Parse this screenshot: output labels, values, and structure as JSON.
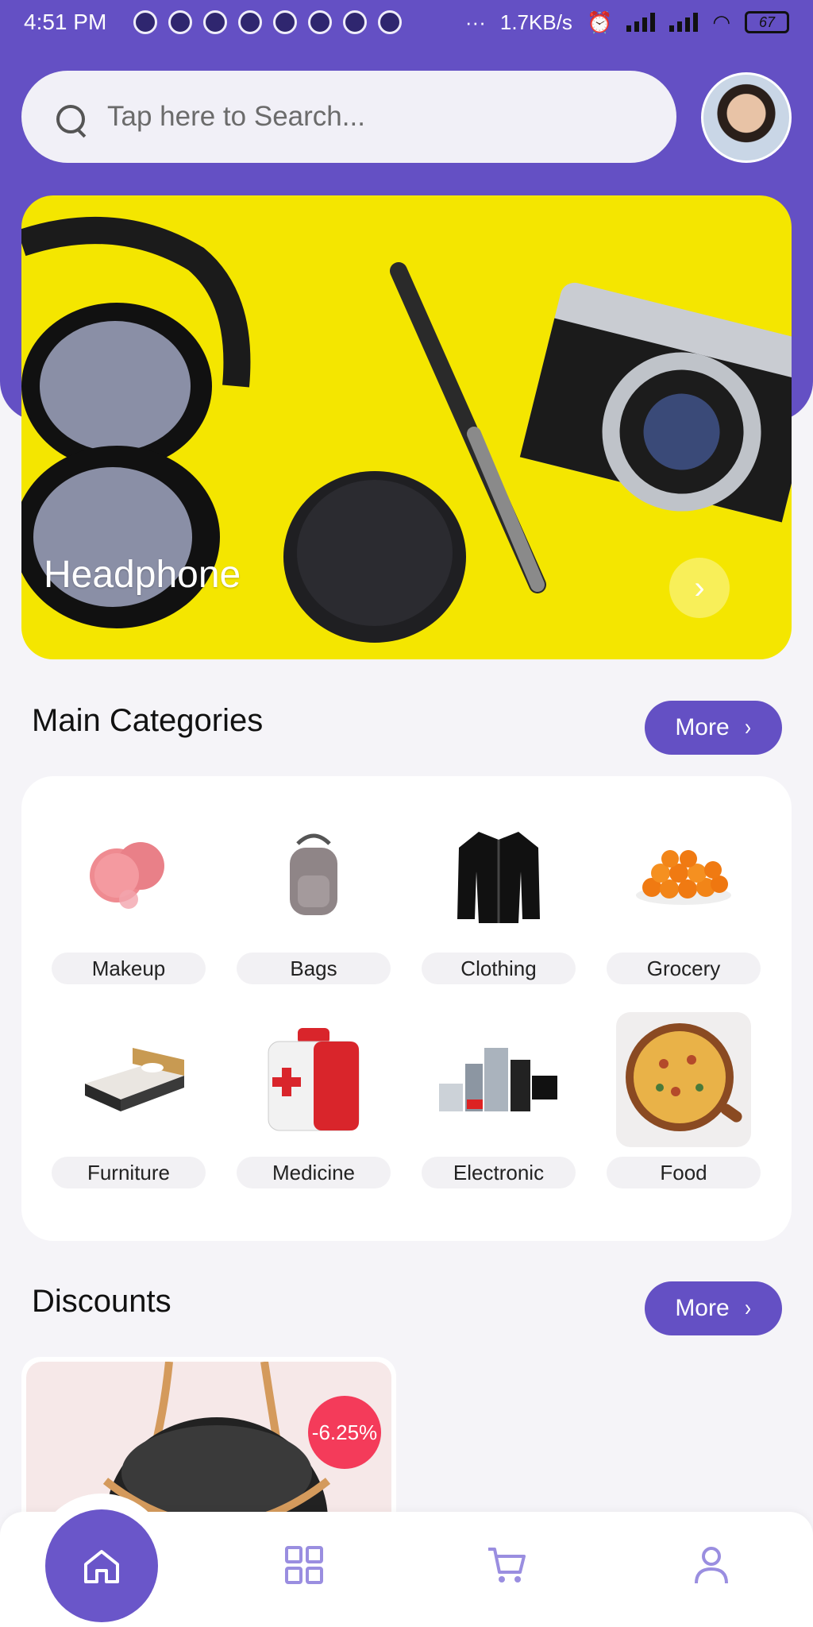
{
  "status_bar": {
    "time": "4:51 PM",
    "network_speed": "1.7KB/s",
    "battery": "67",
    "dots": "···"
  },
  "search": {
    "placeholder": "Tap here to Search..."
  },
  "banner": {
    "title": "Headphone"
  },
  "main_categories": {
    "title": "Main Categories",
    "more_label": "More",
    "items": [
      {
        "label": "Makeup",
        "icon": "makeup-icon"
      },
      {
        "label": "Bags",
        "icon": "bag-icon"
      },
      {
        "label": "Clothing",
        "icon": "jacket-icon"
      },
      {
        "label": "Grocery",
        "icon": "oranges-icon"
      },
      {
        "label": "Furniture",
        "icon": "bed-icon"
      },
      {
        "label": "Medicine",
        "icon": "first-aid-icon"
      },
      {
        "label": "Electronic",
        "icon": "appliances-icon"
      },
      {
        "label": "Food",
        "icon": "pizza-icon"
      }
    ]
  },
  "discounts": {
    "title": "Discounts",
    "more_label": "More",
    "items": [
      {
        "badge": "-6.25%"
      }
    ]
  },
  "bottom_nav": {
    "items": [
      "home-icon",
      "grid-icon",
      "cart-icon",
      "profile-icon"
    ],
    "active": "home"
  },
  "colors": {
    "primary": "#6450c4",
    "badge": "#f43b5a",
    "banner_bg": "#f4e600"
  }
}
